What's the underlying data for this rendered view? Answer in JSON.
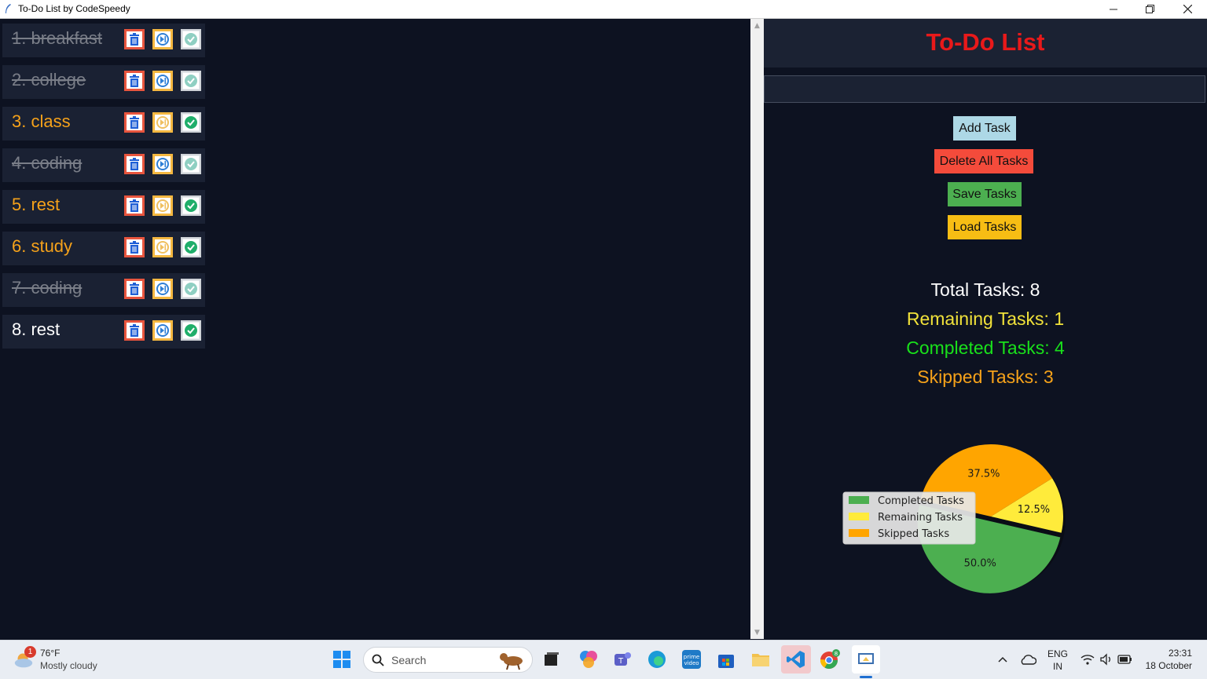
{
  "window": {
    "title": "To-Do List by CodeSpeedy",
    "minimize_icon": "minimize-icon",
    "maximize_icon": "restore-icon",
    "close_icon": "close-icon"
  },
  "tasks": [
    {
      "label": "1. breakfast",
      "status": "completed"
    },
    {
      "label": "2. college",
      "status": "completed"
    },
    {
      "label": "3. class",
      "status": "skipped"
    },
    {
      "label": "4. coding",
      "status": "completed"
    },
    {
      "label": "5. rest",
      "status": "skipped"
    },
    {
      "label": "6. study",
      "status": "skipped"
    },
    {
      "label": "7. coding",
      "status": "completed"
    },
    {
      "label": "8. rest",
      "status": "remaining"
    }
  ],
  "panel": {
    "title": "To-Do List",
    "task_input_value": "",
    "buttons": {
      "add": "Add Task",
      "delete_all": "Delete All Tasks",
      "save": "Save Tasks",
      "load": "Load Tasks"
    },
    "stats": {
      "total": "Total Tasks: 8",
      "remaining": "Remaining Tasks: 1",
      "completed": "Completed Tasks: 4",
      "skipped": "Skipped Tasks: 3"
    }
  },
  "chart_data": {
    "type": "pie",
    "legend_position": "left",
    "slices": [
      {
        "name": "Completed Tasks",
        "value": 50.0,
        "label": "50.0%",
        "color": "#4caf50"
      },
      {
        "name": "Remaining Tasks",
        "value": 12.5,
        "label": "12.5%",
        "color": "#ffeb3b"
      },
      {
        "name": "Skipped Tasks",
        "value": 37.5,
        "label": "37.5%",
        "color": "#ffa500"
      }
    ]
  },
  "colors": {
    "background": "#0d1221",
    "row_bg": "#1a2133",
    "title_red": "#e8191a",
    "completed_text": "#7a7e88",
    "skipped_text": "#f6a21a"
  },
  "taskbar": {
    "weather_temp": "76°F",
    "weather_desc": "Mostly cloudy",
    "weather_badge": "1",
    "search_placeholder": "Search",
    "language_top": "ENG",
    "language_bottom": "IN",
    "time": "23:31",
    "date": "18 October"
  }
}
